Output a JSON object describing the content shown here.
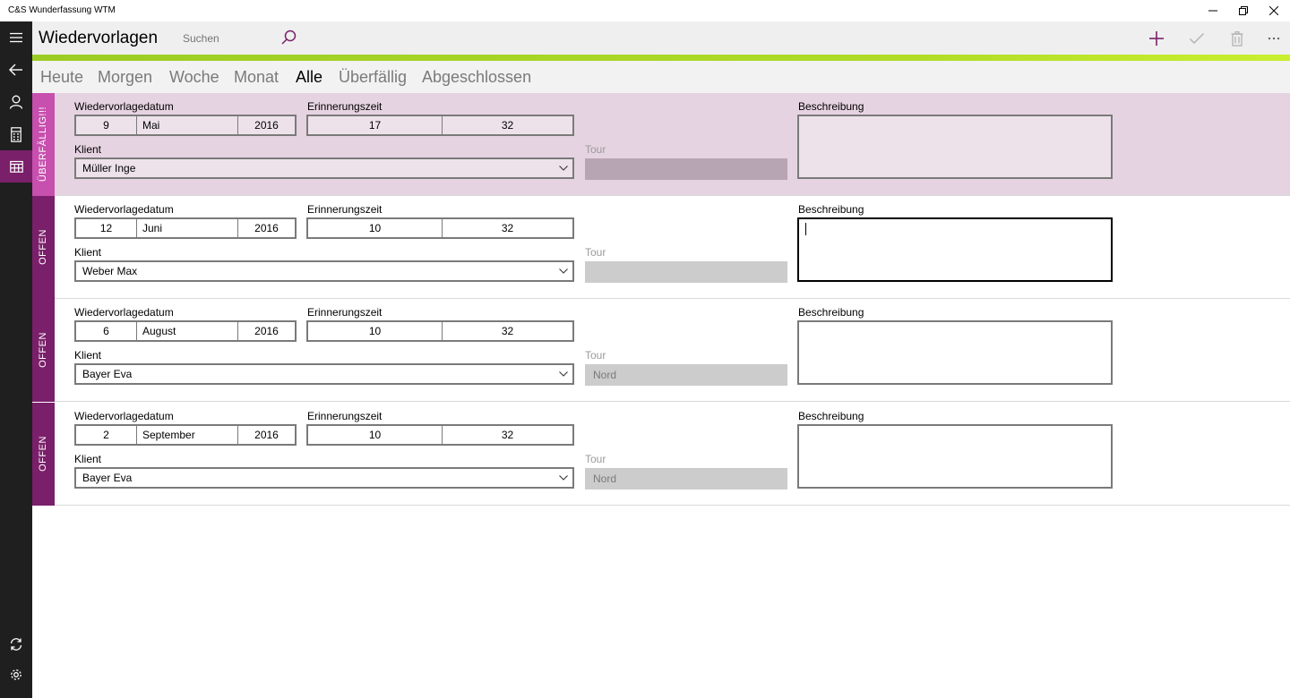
{
  "window": {
    "title": "C&S Wunderfassung WTM"
  },
  "header": {
    "title": "Wiedervorlagen",
    "search_placeholder": "Suchen"
  },
  "tabs": [
    {
      "label": "Heute",
      "active": false
    },
    {
      "label": "Morgen",
      "active": false
    },
    {
      "label": "Woche",
      "active": false
    },
    {
      "label": "Monat",
      "active": false
    },
    {
      "label": "Alle",
      "active": true
    },
    {
      "label": "Überfällig",
      "active": false
    },
    {
      "label": "Abgeschlossen",
      "active": false
    }
  ],
  "labels": {
    "date": "Wiedervorlagedatum",
    "time": "Erinnerungszeit",
    "client": "Klient",
    "tour": "Tour",
    "description": "Beschreibung"
  },
  "items": [
    {
      "status": "ÜBERFÄLLIG!!!",
      "day": "9",
      "month": "Mai",
      "year": "2016",
      "hour": "17",
      "minute": "32",
      "client": "Müller Inge",
      "tour": "",
      "description": ""
    },
    {
      "status": "OFFEN",
      "day": "12",
      "month": "Juni",
      "year": "2016",
      "hour": "10",
      "minute": "32",
      "client": "Weber Max",
      "tour": "",
      "description": ""
    },
    {
      "status": "OFFEN",
      "day": "6",
      "month": "August",
      "year": "2016",
      "hour": "10",
      "minute": "32",
      "client": "Bayer Eva",
      "tour": "Nord",
      "description": ""
    },
    {
      "status": "OFFEN",
      "day": "2",
      "month": "September",
      "year": "2016",
      "hour": "10",
      "minute": "32",
      "client": "Bayer Eva",
      "tour": "Nord",
      "description": ""
    }
  ],
  "colors": {
    "accent": "#7a1f6a",
    "overdue": "#c74fae",
    "overdue_bg": "#e6d3e1",
    "lime": "#b0dc28",
    "rail": "#1f1f1f"
  },
  "icons": {
    "rail": [
      "hamburger-icon",
      "back-arrow-icon",
      "person-icon",
      "calculator-icon",
      "calendar-icon",
      "sync-icon",
      "gear-icon"
    ],
    "header": [
      "search-icon",
      "add-icon",
      "checkmark-icon",
      "delete-icon",
      "more-icon"
    ]
  }
}
